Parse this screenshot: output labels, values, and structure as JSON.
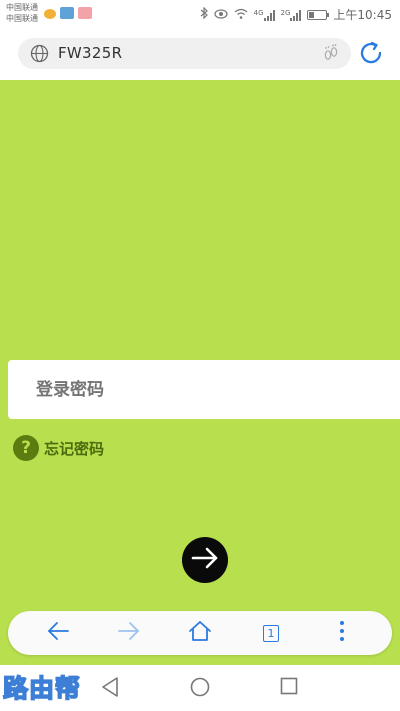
{
  "status_bar": {
    "carrier_1": "中国联通",
    "carrier_2": "中国联通",
    "network_1": "4G",
    "network_2": "2G",
    "time": "上午10:45",
    "battery_level": 0.3
  },
  "address_bar": {
    "url": "FW325R"
  },
  "login": {
    "password_placeholder": "登录密码",
    "forgot_password": "忘记密码",
    "help_symbol": "?"
  },
  "toolbar": {
    "tab_count": "1"
  },
  "watermark": {
    "text": "路由帮"
  },
  "colors": {
    "page_background": "#b8e04e",
    "accent_blue": "#2a7be0",
    "forgot_text": "#4d6b0e",
    "submit_button": "#0a0a0a"
  }
}
